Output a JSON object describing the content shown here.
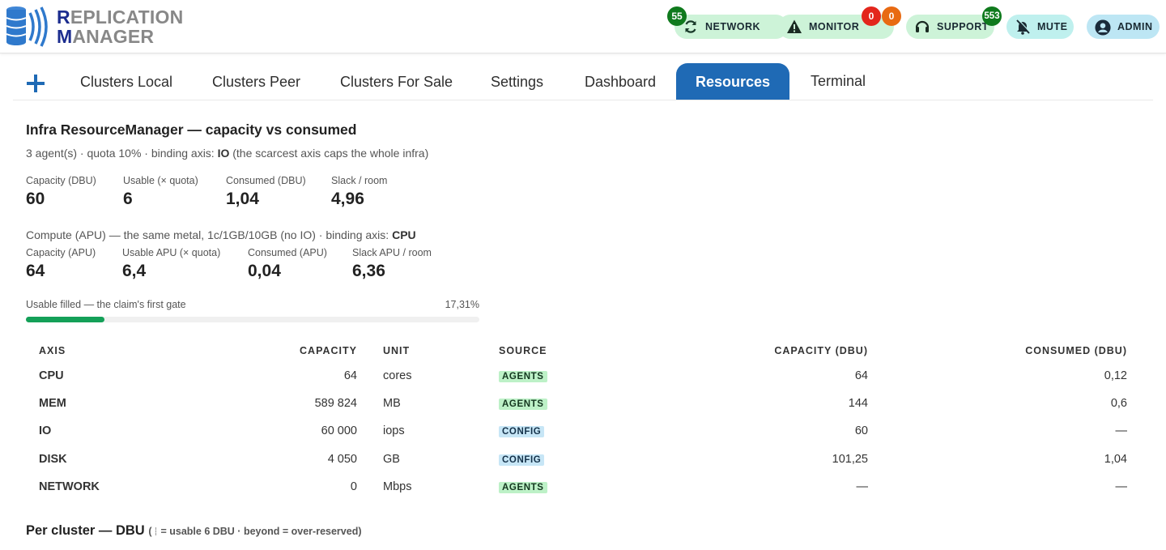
{
  "brand": {
    "line1_first": "R",
    "line1_rest": "EPLICATION",
    "line2_first": "M",
    "line2_rest": "ANAGER"
  },
  "header": {
    "network": {
      "label": "NETWORK",
      "badge": "55",
      "icon": "refresh-icon"
    },
    "monitor": {
      "label": "MONITOR",
      "badge_red": "0",
      "badge_orange": "0",
      "icon": "warning-icon"
    },
    "support": {
      "label": "SUPPORT",
      "badge": "553",
      "icon": "headset-icon"
    },
    "mute": {
      "label": "MUTE",
      "icon": "bell-off-icon"
    },
    "admin": {
      "label": "ADMIN",
      "icon": "user-circle-icon"
    }
  },
  "tabs": [
    {
      "label": "Clusters Local"
    },
    {
      "label": "Clusters Peer"
    },
    {
      "label": "Clusters For Sale"
    },
    {
      "label": "Settings"
    },
    {
      "label": "Dashboard"
    },
    {
      "label": "Resources",
      "active": true
    },
    {
      "label": "Terminal"
    }
  ],
  "infra": {
    "title": "Infra ResourceManager — capacity vs consumed",
    "subline_prefix": "3 agent(s) · quota 10% · binding axis: ",
    "subline_axis": "IO",
    "subline_suffix": " (the scarcest axis caps the whole infra)",
    "dbu": [
      {
        "label": "Capacity (DBU)",
        "value": "60"
      },
      {
        "label": "Usable (× quota)",
        "value": "6"
      },
      {
        "label": "Consumed (DBU)",
        "value": "1,04"
      },
      {
        "label": "Slack / room",
        "value": "4,96"
      }
    ],
    "compute_prefix": "Compute (APU) — the same metal, 1c/1GB/10GB (no IO) · binding axis: ",
    "compute_axis": "CPU",
    "apu": [
      {
        "label": "Capacity (APU)",
        "value": "64"
      },
      {
        "label": "Usable APU (× quota)",
        "value": "6,4"
      },
      {
        "label": "Consumed (APU)",
        "value": "0,04"
      },
      {
        "label": "Slack APU / room",
        "value": "6,36"
      }
    ],
    "progress": {
      "label": "Usable filled — the claim's first gate",
      "pct_text": "17,31%",
      "fraction": 0.1731
    }
  },
  "table": {
    "headers": {
      "axis": "AXIS",
      "capacity": "CAPACITY",
      "unit": "UNIT",
      "source": "SOURCE",
      "capacity_dbu": "CAPACITY (DBU)",
      "consumed_dbu": "CONSUMED (DBU)"
    },
    "rows": [
      {
        "axis": "CPU",
        "capacity": "64",
        "unit": "cores",
        "source": "AGENTS",
        "capacity_dbu": "64",
        "consumed_dbu": "0,12"
      },
      {
        "axis": "MEM",
        "capacity": "589 824",
        "unit": "MB",
        "source": "AGENTS",
        "capacity_dbu": "144",
        "consumed_dbu": "0,6"
      },
      {
        "axis": "IO",
        "capacity": "60 000",
        "unit": "iops",
        "source": "CONFIG",
        "capacity_dbu": "60",
        "consumed_dbu": "—"
      },
      {
        "axis": "DISK",
        "capacity": "4 050",
        "unit": "GB",
        "source": "CONFIG",
        "capacity_dbu": "101,25",
        "consumed_dbu": "1,04"
      },
      {
        "axis": "NETWORK",
        "capacity": "0",
        "unit": "Mbps",
        "source": "AGENTS",
        "capacity_dbu": "—",
        "consumed_dbu": "—"
      }
    ]
  },
  "per_cluster": {
    "title": "Per cluster — DBU",
    "note_open": "(",
    "note_text": "= usable 6 DBU · beyond = over-reserved)"
  },
  "colors": {
    "tab_active": "#1f6ab5",
    "progress_fill": "#14a058",
    "badge_green": "#0f7a1d",
    "badge_red": "#e3261c",
    "badge_orange": "#e86a12",
    "brand_blue": "#1c2d8f"
  }
}
